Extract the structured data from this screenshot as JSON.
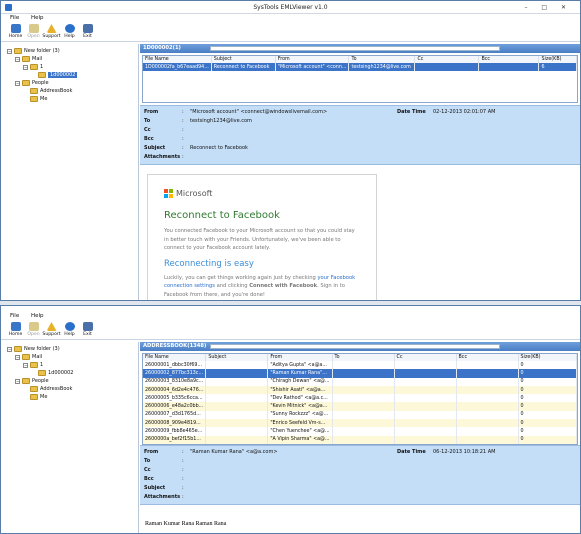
{
  "window": {
    "title": "SysTools EMLViewer v1.0",
    "controls": "–  □  ✕"
  },
  "menu": {
    "file": "File",
    "help": "Help"
  },
  "toolbar": {
    "home": "Home",
    "open": "Open",
    "support": "Support",
    "help": "Help",
    "exit": "Exit"
  },
  "tree": {
    "root": "New folder (3)",
    "mail": "Mail",
    "one": "1",
    "leaf": "1d000002",
    "people": "People",
    "addressbook": "AddressBook",
    "me": "Me",
    "expander_open": "−",
    "expander_closed": "+"
  },
  "view1": {
    "header": "1D000002(1)",
    "columns": [
      "File Name",
      "Subject",
      "From",
      "To",
      "Cc",
      "Bcc",
      "Size(KB)"
    ],
    "rows": [
      {
        "file": "1D000002fa_b67eaad94...",
        "subject": "Reconnect to Facebook",
        "from": "\"Microsoft account\" <conn...",
        "to": "testsingh1234@live.com",
        "cc": "",
        "bcc": "",
        "size": "6"
      }
    ],
    "meta": {
      "from_label": "From",
      "from": "\"Microsoft account\" <connect@windowslivemail.com>",
      "date_label": "Date Time",
      "date": "02-12-2013 02:01:07 AM",
      "to_label": "To",
      "to": "testsingh1234@live.com",
      "cc_label": "Cc",
      "bcc_label": "Bcc",
      "subject_label": "Subject",
      "subject": "Reconnect to Facebook",
      "attach_label": "Attachments",
      "colon": ":"
    },
    "email": {
      "brand": "Microsoft",
      "title": "Reconnect to Facebook",
      "para1": "You connected Facebook to your Microsoft account so that you could stay in better touch with your Friends. Unfortunately, we've been able to connect to your Facebook account lately.",
      "subtitle": "Reconnecting is easy",
      "para2_a": "Luckily, you can get things working again just by checking ",
      "para2_link1": "your Facebook connection settings",
      "para2_b": " and clicking ",
      "para2_bold": "Connect with Facebook",
      "para2_c": ". Sign in to Facebook from there, and you're done!"
    }
  },
  "view2": {
    "header": "ADDRESSBOOK(1348)",
    "columns": [
      "File Name",
      "Subject",
      "From",
      "To",
      "Cc",
      "Bcc",
      "Size(KB)"
    ],
    "rows": [
      {
        "file": "26000001_dbbc30f69...",
        "from": "\"Aditya Gupta\" <a@a...",
        "size": "0",
        "style": "plain"
      },
      {
        "file": "26000002_877bc313c...",
        "from": "\"Raman Kumar Rana\"...",
        "size": "0",
        "style": "hl"
      },
      {
        "file": "26000003_8310e8a9c...",
        "from": "\"Chiragh Dewan\" <a@...",
        "size": "0",
        "style": "plain"
      },
      {
        "file": "26000004_6d2e4c476...",
        "from": "\"Shishir Asati\" <a@a...",
        "size": "0",
        "style": "yel"
      },
      {
        "file": "26000005_b335c6cca...",
        "from": "\"Dev Rathod\" <a@a.c...",
        "size": "0",
        "style": "plain"
      },
      {
        "file": "26000006_e48a2c0bb...",
        "from": "\"Kevin Mitnick\" <a@a...",
        "size": "0",
        "style": "yel"
      },
      {
        "file": "26000007_d3d1765d...",
        "from": "\"Sunny Rockzzz\" <a@...",
        "size": "0",
        "style": "plain"
      },
      {
        "file": "26000008_909e4819...",
        "from": "\"Enrico Seefeld Vm-s...",
        "size": "0",
        "style": "yel"
      },
      {
        "file": "26000009_fbb8e465e...",
        "from": "\"Chen Yuenchee\" <a@...",
        "size": "0",
        "style": "plain"
      },
      {
        "file": "2600000a_bef2f15b1...",
        "from": "\"A Vipin Sharma\" <a@...",
        "size": "0",
        "style": "yel"
      }
    ],
    "meta": {
      "from_label": "From",
      "from": "\"Raman Kumar Rana\" <a@a.com>",
      "date_label": "Date Time",
      "date": "06-12-2013 10:18:21 AM",
      "to_label": "To",
      "cc_label": "Cc",
      "bcc_label": "Bcc",
      "subject_label": "Subject",
      "attach_label": "Attachments",
      "colon": ":"
    },
    "body": "Raman Kumar Rana Raman Rana"
  }
}
